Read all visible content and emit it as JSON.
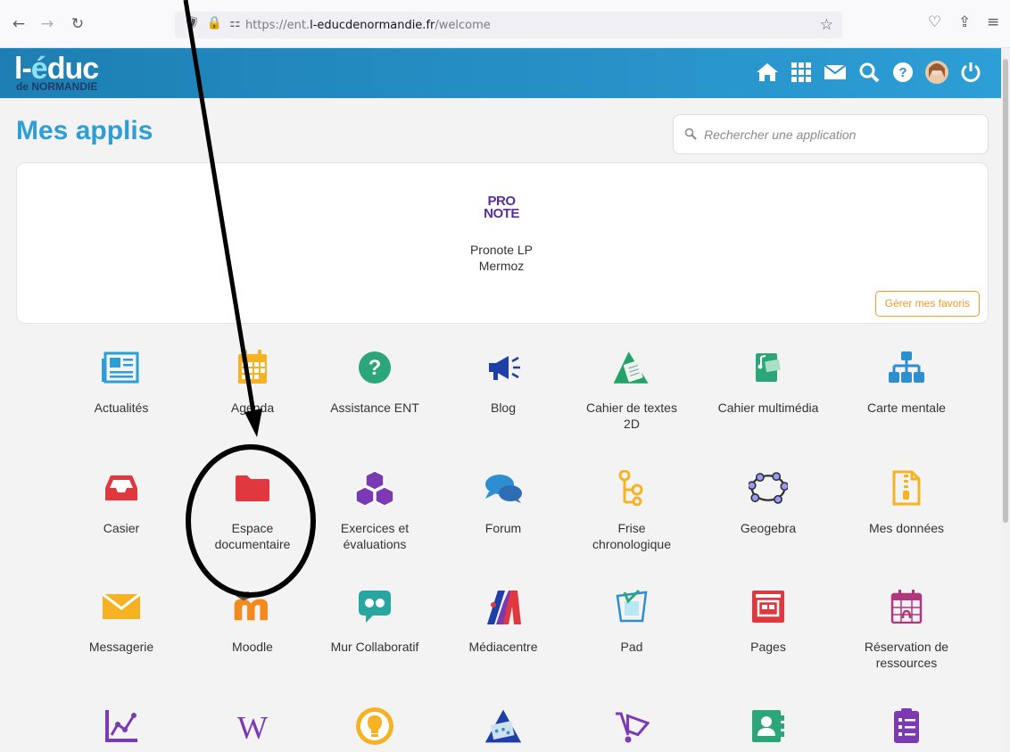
{
  "browser": {
    "url_prefix": "https://ent.",
    "url_domain": "l-educdenormandie.fr",
    "url_path": "/welcome"
  },
  "header": {
    "logo_main_prefix": "l-",
    "logo_main_e": "é",
    "logo_main_suffix": "duc",
    "logo_sub": "de NORMANDIE"
  },
  "page": {
    "title": "Mes applis",
    "search_placeholder": "Rechercher une application"
  },
  "favorites": {
    "logo_line1": "PRO",
    "logo_line2": "NOTE",
    "app_line1": "Pronote LP",
    "app_line2": "Mermoz",
    "manage_label": "Gérer mes favoris"
  },
  "apps": [
    {
      "line1": "Actualités",
      "line2": "",
      "icon": "newspaper-icon",
      "color": "#2d9ed6"
    },
    {
      "line1": "Agenda",
      "line2": "",
      "icon": "calendar-icon",
      "color": "#f5b324"
    },
    {
      "line1": "Assistance ENT",
      "line2": "",
      "icon": "question-icon",
      "color": "#2aa678"
    },
    {
      "line1": "Blog",
      "line2": "",
      "icon": "megaphone-icon",
      "color": "#1f3fa8"
    },
    {
      "line1": "Cahier de textes",
      "line2": "2D",
      "icon": "notebook-icon",
      "color": "#22a36b"
    },
    {
      "line1": "Cahier multimédia",
      "line2": "",
      "icon": "multimedia-book-icon",
      "color": "#2aa678"
    },
    {
      "line1": "Carte mentale",
      "line2": "",
      "icon": "sitemap-icon",
      "color": "#2d8fd2"
    },
    {
      "line1": "Casier",
      "line2": "",
      "icon": "inbox-tray-icon",
      "color": "#e0383e"
    },
    {
      "line1": "Espace",
      "line2": "documentaire",
      "icon": "folder-icon",
      "color": "#e0383e"
    },
    {
      "line1": "Exercices et",
      "line2": "évaluations",
      "icon": "cubes-icon",
      "color": "#7b3ab3"
    },
    {
      "line1": "Forum",
      "line2": "",
      "icon": "chat-bubbles-icon",
      "color": "#2d8fd2"
    },
    {
      "line1": "Frise",
      "line2": "chronologique",
      "icon": "timeline-icon",
      "color": "#f5b324"
    },
    {
      "line1": "Geogebra",
      "line2": "",
      "icon": "geogebra-icon",
      "color": "#6a6ad6"
    },
    {
      "line1": "Mes données",
      "line2": "",
      "icon": "zip-file-icon",
      "color": "#f5b324"
    },
    {
      "line1": "Messagerie",
      "line2": "",
      "icon": "envelope-icon",
      "color": "#f5b324"
    },
    {
      "line1": "Moodle",
      "line2": "",
      "icon": "moodle-icon",
      "color": "#f38a1d"
    },
    {
      "line1": "Mur Collaboratif",
      "line2": "",
      "icon": "board-icon",
      "color": "#2aa6a0"
    },
    {
      "line1": "Médiacentre",
      "line2": "",
      "icon": "mediacentre-icon",
      "color": "#e0383e"
    },
    {
      "line1": "Pad",
      "line2": "",
      "icon": "pad-icon",
      "color": "#2d8fd2"
    },
    {
      "line1": "Pages",
      "line2": "",
      "icon": "pages-icon",
      "color": "#e0383e"
    },
    {
      "line1": "Réservation de",
      "line2": "ressources",
      "icon": "booking-calendar-icon",
      "color": "#b0367d"
    },
    {
      "line1": "",
      "line2": "",
      "icon": "stats-chart-icon",
      "color": "#7b3ab3"
    },
    {
      "line1": "",
      "line2": "",
      "icon": "wiki-icon",
      "color": "#7b3ab3"
    },
    {
      "line1": "",
      "line2": "",
      "icon": "lightbulb-icon",
      "color": "#f5b324"
    },
    {
      "line1": "",
      "line2": "",
      "icon": "triangle-app-icon",
      "color": "#1f3fa8"
    },
    {
      "line1": "",
      "line2": "",
      "icon": "cart-icon",
      "color": "#7b3ab3"
    },
    {
      "line1": "",
      "line2": "",
      "icon": "contact-card-icon",
      "color": "#2aa678"
    },
    {
      "line1": "",
      "line2": "",
      "icon": "checklist-icon",
      "color": "#7b3ab3"
    }
  ]
}
